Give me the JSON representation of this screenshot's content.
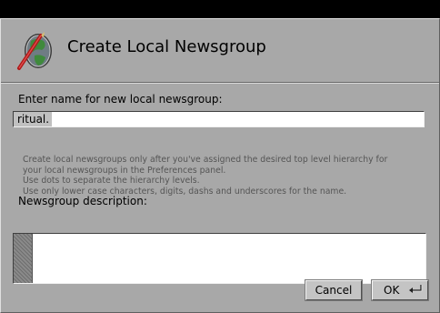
{
  "dialog": {
    "title": "Create Local Newsgroup",
    "icon": "globe-newsgroup-icon"
  },
  "name_field": {
    "label": "Enter name for new local newsgroup:",
    "value": "ritual."
  },
  "help_lines": [
    "Create local newsgroups only after you've assigned the desired top level hierarchy for",
    "your local newsgroups in the Preferences panel.",
    "Use dots to separate the hierarchy levels.",
    "Use only lower case characters, digits, dashs and underscores for the name."
  ],
  "description_field": {
    "label": "Newsgroup description:",
    "value": ""
  },
  "buttons": {
    "cancel": "Cancel",
    "ok": "OK"
  },
  "colors": {
    "background": "#a8a8a8",
    "titlebar": "#000000",
    "field": "#ffffff",
    "help_text": "#555555"
  }
}
